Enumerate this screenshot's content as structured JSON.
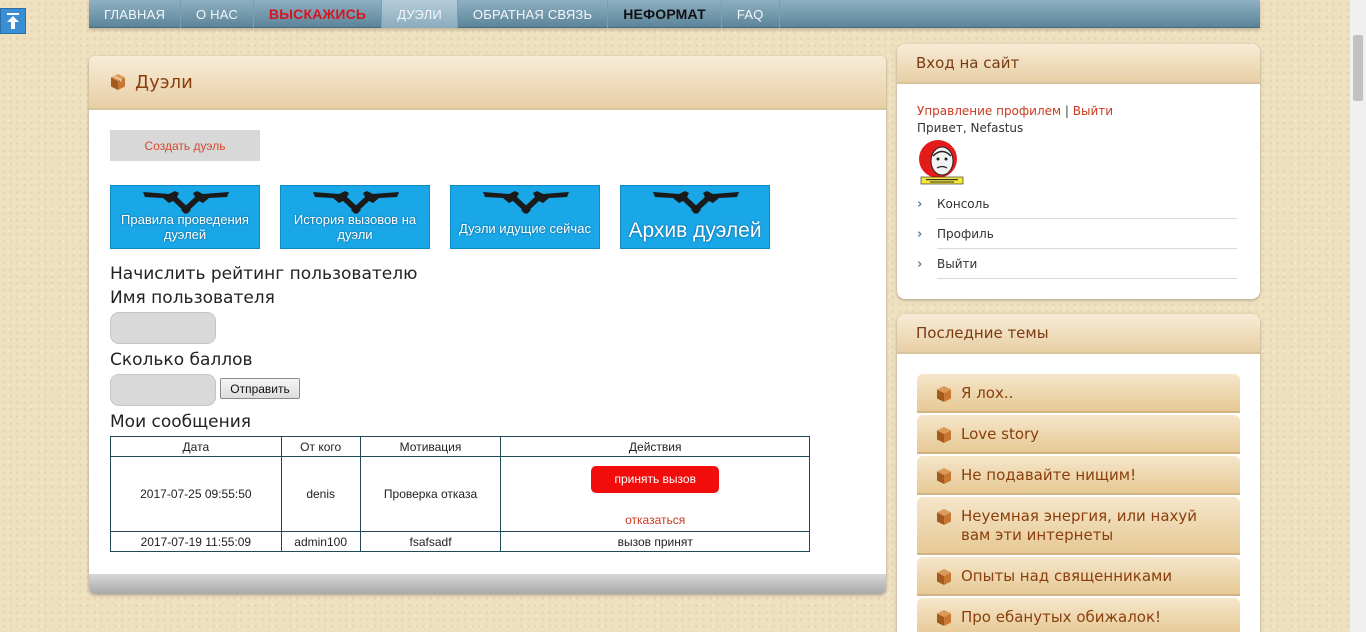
{
  "nav": {
    "items": [
      "ГЛАВНАЯ",
      "О НАС",
      "ВЫСКАЖИСЬ",
      "ДУЭЛИ",
      "ОБРАТНАЯ СВЯЗЬ",
      "НЕФОРМАТ",
      "FAQ"
    ]
  },
  "main": {
    "title": "Дуэли",
    "create_button": "Создать дуэль",
    "banners": [
      "Правила проведения дуэлей",
      "История вызовов на дуэли",
      "Дуэли идущие сейчас",
      "Архив дуэлей"
    ],
    "rating_heading": "Начислить рейтинг пользователю",
    "username_label": "Имя пользователя",
    "points_label": "Сколько баллов",
    "submit_button": "Отправить",
    "messages_heading": "Мои сообщения",
    "table": {
      "headers": [
        "Дата",
        "От кого",
        "Мотивация",
        "Действия"
      ],
      "rows": [
        {
          "date": "2017-07-25 09:55:50",
          "from": "denis",
          "motivation": "Проверка отказа",
          "accept": "принять вызов",
          "decline": "отказаться"
        },
        {
          "date": "2017-07-19 11:55:09",
          "from": "admin100",
          "motivation": "fsafsadf",
          "status": "вызов принят"
        }
      ]
    }
  },
  "login": {
    "title": "Вход на сайт",
    "profile_link": "Управление профилем",
    "separator": "|",
    "logout_link": "Выйти",
    "greeting": "Привет, Nefastus",
    "menu": [
      "Консоль",
      "Профиль",
      "Выйти"
    ]
  },
  "topics": {
    "title": "Последние темы",
    "items": [
      "Я лох..",
      "Love story",
      "Не подавайте нищим!",
      "Неуемная энергия, или нахуй вам эти интернеты",
      "Опыты над священниками",
      "Про ебанутых обижалок!"
    ]
  },
  "colors": {
    "accent": "#8a3f0c",
    "link": "#c9391f",
    "nav": "#5c8499",
    "banner": "#19a7e8",
    "accept": "#f20c0c"
  }
}
